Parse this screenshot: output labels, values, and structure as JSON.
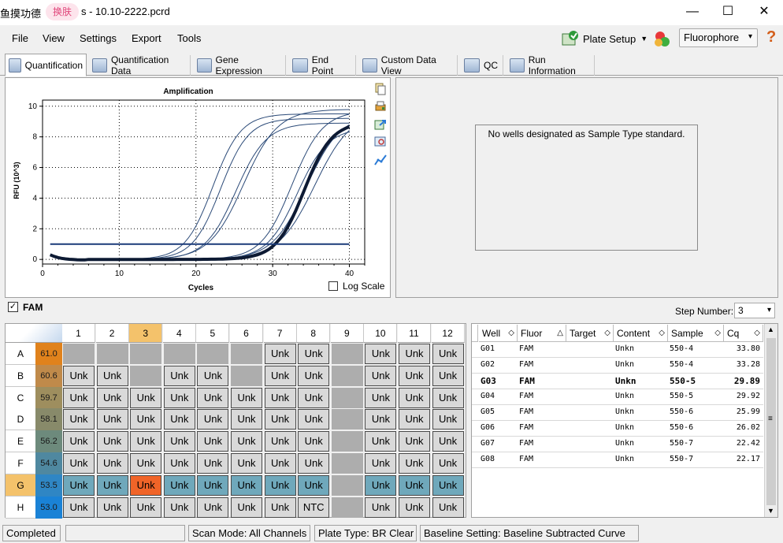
{
  "window": {
    "title_prefix": "鱼摸功德",
    "pill": "换肤",
    "title_suffix": "s - 10.10-2222.pcrd",
    "buttons": {
      "minimize": "—",
      "maximize": "☐",
      "close": "✕"
    }
  },
  "menu": {
    "file": "File",
    "view": "View",
    "settings": "Settings",
    "export": "Export",
    "tools": "Tools",
    "plate_setup": "Plate Setup",
    "fluorophore": "Fluorophore"
  },
  "tabs": [
    "Quantification",
    "Quantification Data",
    "Gene Expression",
    "End Point",
    "Custom Data View",
    "QC",
    "Run Information"
  ],
  "chart": {
    "title": "Amplification",
    "xlabel": "Cycles",
    "ylabel": "RFU (10^3)",
    "log_scale_label": "Log Scale"
  },
  "chart_data": {
    "type": "line",
    "title": "Amplification",
    "xlabel": "Cycles",
    "ylabel": "RFU (10^3)",
    "xlim": [
      0,
      42
    ],
    "ylim": [
      -0.3,
      10.4
    ],
    "xticks": [
      0,
      10,
      20,
      30,
      40
    ],
    "yticks": [
      0,
      2,
      4,
      6,
      8,
      10
    ],
    "grid": true,
    "threshold": 1.0,
    "series": [
      {
        "ct": 22.2,
        "plateau": 9.5,
        "k": 0.55,
        "bold": false
      },
      {
        "ct": 23.2,
        "plateau": 9.2,
        "k": 0.55,
        "bold": false
      },
      {
        "ct": 25.2,
        "plateau": 8.9,
        "k": 0.5,
        "bold": false
      },
      {
        "ct": 26.2,
        "plateau": 9.8,
        "k": 0.45,
        "bold": false
      },
      {
        "ct": 32.5,
        "plateau": 9.7,
        "k": 0.5,
        "bold": false
      },
      {
        "ct": 33.2,
        "plateau": 8.6,
        "k": 0.5,
        "bold": false
      },
      {
        "ct": 34.4,
        "plateau": 9.5,
        "k": 0.45,
        "bold": false
      },
      {
        "ct": 35.5,
        "plateau": 9.7,
        "k": 0.42,
        "bold": false
      },
      {
        "ct": 34.1,
        "plateau": 9.0,
        "k": 0.55,
        "bold": true
      }
    ]
  },
  "standard_message": "No wells designated as Sample Type standard.",
  "fam": {
    "label": "FAM",
    "step_label": "Step Number:",
    "step_value": "3"
  },
  "plate": {
    "columns": [
      "1",
      "2",
      "3",
      "4",
      "5",
      "6",
      "7",
      "8",
      "9",
      "10",
      "11",
      "12"
    ],
    "selected_col": 3,
    "rows": [
      {
        "label": "A",
        "temp": "61.0",
        "color": "#e0821c",
        "wells": [
          "",
          "",
          "",
          "",
          "",
          "",
          "Unk",
          "Unk",
          "",
          "Unk",
          "Unk",
          "Unk"
        ]
      },
      {
        "label": "B",
        "temp": "60.6",
        "color": "#c08a4a",
        "wells": [
          "Unk",
          "Unk",
          "",
          "Unk",
          "Unk",
          "",
          "Unk",
          "Unk",
          "",
          "Unk",
          "Unk",
          "Unk"
        ]
      },
      {
        "label": "C",
        "temp": "59.7",
        "color": "#9e8e5e",
        "wells": [
          "Unk",
          "Unk",
          "Unk",
          "Unk",
          "Unk",
          "Unk",
          "Unk",
          "Unk",
          "",
          "Unk",
          "Unk",
          "Unk"
        ]
      },
      {
        "label": "D",
        "temp": "58.1",
        "color": "#888a6a",
        "wells": [
          "Unk",
          "Unk",
          "Unk",
          "Unk",
          "Unk",
          "Unk",
          "Unk",
          "Unk",
          "",
          "Unk",
          "Unk",
          "Unk"
        ]
      },
      {
        "label": "E",
        "temp": "56.2",
        "color": "#6d8a7c",
        "wells": [
          "Unk",
          "Unk",
          "Unk",
          "Unk",
          "Unk",
          "Unk",
          "Unk",
          "Unk",
          "",
          "Unk",
          "Unk",
          "Unk"
        ]
      },
      {
        "label": "F",
        "temp": "54.6",
        "color": "#4f88a0",
        "wells": [
          "Unk",
          "Unk",
          "Unk",
          "Unk",
          "Unk",
          "Unk",
          "Unk",
          "Unk",
          "",
          "Unk",
          "Unk",
          "Unk"
        ]
      },
      {
        "label": "G",
        "temp": "53.5",
        "color": "#2f86c4",
        "wells": [
          "Unk",
          "Unk",
          "Unk",
          "Unk",
          "Unk",
          "Unk",
          "Unk",
          "Unk",
          "",
          "Unk",
          "Unk",
          "Unk"
        ]
      },
      {
        "label": "H",
        "temp": "53.0",
        "color": "#1a82d6",
        "wells": [
          "Unk",
          "Unk",
          "Unk",
          "Unk",
          "Unk",
          "Unk",
          "Unk",
          "NTC",
          "",
          "Unk",
          "Unk",
          "Unk"
        ]
      }
    ],
    "selected_row": 6
  },
  "table": {
    "headers": [
      "Well",
      "Fluor",
      "Target",
      "Content",
      "Sample",
      "Cq"
    ],
    "rows": [
      {
        "well": "G01",
        "fluor": "FAM",
        "target": "",
        "content": "Unkn",
        "sample": "550-4",
        "cq": "33.80"
      },
      {
        "well": "G02",
        "fluor": "FAM",
        "target": "",
        "content": "Unkn",
        "sample": "550-4",
        "cq": "33.28"
      },
      {
        "well": "G03",
        "fluor": "FAM",
        "target": "",
        "content": "Unkn",
        "sample": "550-5",
        "cq": "29.89",
        "bold": true
      },
      {
        "well": "G04",
        "fluor": "FAM",
        "target": "",
        "content": "Unkn",
        "sample": "550-5",
        "cq": "29.92"
      },
      {
        "well": "G05",
        "fluor": "FAM",
        "target": "",
        "content": "Unkn",
        "sample": "550-6",
        "cq": "25.99"
      },
      {
        "well": "G06",
        "fluor": "FAM",
        "target": "",
        "content": "Unkn",
        "sample": "550-6",
        "cq": "26.02"
      },
      {
        "well": "G07",
        "fluor": "FAM",
        "target": "",
        "content": "Unkn",
        "sample": "550-7",
        "cq": "22.42"
      },
      {
        "well": "G08",
        "fluor": "FAM",
        "target": "",
        "content": "Unkn",
        "sample": "550-7",
        "cq": "22.17"
      }
    ]
  },
  "status": {
    "completed": "Completed",
    "scan_mode": "Scan Mode: All Channels",
    "plate_type": "Plate Type: BR Clear",
    "baseline": "Baseline Setting: Baseline Subtracted Curve Fit"
  }
}
